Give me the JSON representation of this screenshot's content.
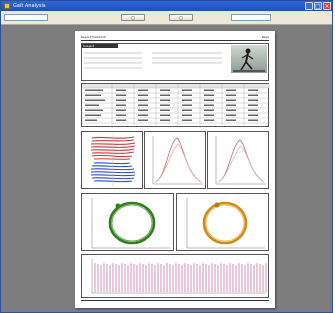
{
  "window": {
    "title": "Gait Analysis",
    "buttons": [
      "_",
      "□",
      "×"
    ]
  },
  "toolbar": {
    "left_field": "",
    "button1": "▢",
    "button2": "▢",
    "right_field": ""
  },
  "report": {
    "header_left": "Report  Treadmill",
    "header_right": "Page",
    "section_title": "Subject",
    "footer_left": "",
    "footer_right": ""
  },
  "colors": {
    "titlebar": "#1f4fbf",
    "paper_bg": "#7d7d7d",
    "loop_green": "#2f7d1e",
    "loop_orange": "#d08a12",
    "pressure_red": "#c83a3a",
    "pressure_blue": "#2c49c9",
    "waveform": "#b84a8a"
  }
}
